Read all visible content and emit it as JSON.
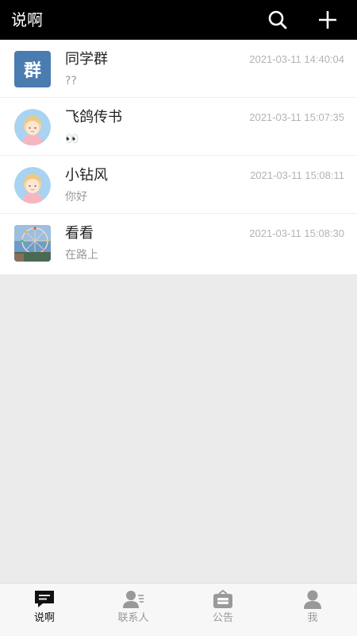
{
  "header": {
    "title": "说啊",
    "icons": [
      "search-icon",
      "plus-icon"
    ]
  },
  "conversations": [
    {
      "name": "同学群",
      "preview": "??",
      "time": "2021-03-11 14:40:04",
      "avatar": "group",
      "avatar_text": "群"
    },
    {
      "name": "飞鸽传书",
      "preview": "👀",
      "time": "2021-03-11 15:07:35",
      "avatar": "girl"
    },
    {
      "name": "小钻风",
      "preview": "你好",
      "time": "2021-03-11 15:08:11",
      "avatar": "girl"
    },
    {
      "name": "看看",
      "preview": "在路上",
      "time": "2021-03-11 15:08:30",
      "avatar": "photo"
    }
  ],
  "tabbar": {
    "tabs": [
      {
        "label": "说啊",
        "icon": "chat-icon",
        "active": true
      },
      {
        "label": "联系人",
        "icon": "contacts-icon",
        "active": false
      },
      {
        "label": "公告",
        "icon": "announcement-icon",
        "active": false
      },
      {
        "label": "我",
        "icon": "profile-icon",
        "active": false
      }
    ]
  },
  "colors": {
    "header_bg": "#000000",
    "page_bg": "#ebebeb",
    "group_avatar_bg": "#4a7cb0",
    "avatar_circle_bg": "#a9d3f0",
    "time_text": "#b3b3b3"
  }
}
